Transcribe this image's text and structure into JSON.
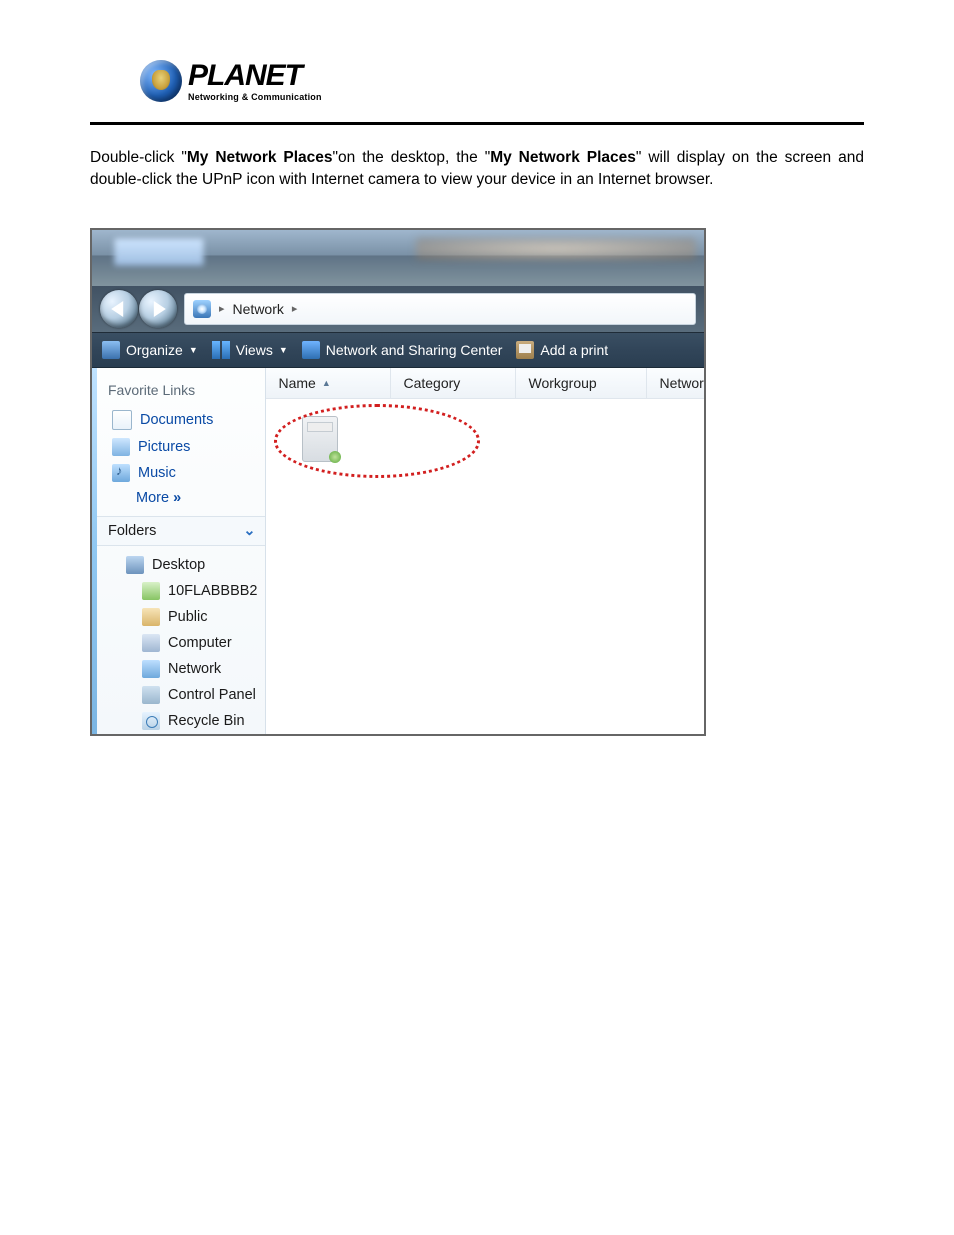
{
  "logo": {
    "brand": "PLANET",
    "tagline": "Networking & Communication"
  },
  "body": {
    "pre1": "Double-click \"",
    "b1": "My Network Places",
    "mid1": "\"on the desktop, the \"",
    "b2": "My Network Places",
    "post": "\" will display on the screen and double-click the UPnP icon with Internet camera to view your device in an Internet browser."
  },
  "addr": {
    "loc": "Network",
    "sep1": "▸",
    "sep2": "▸"
  },
  "toolbar": {
    "organize": "Organize",
    "views": "Views",
    "nsc": "Network and Sharing Center",
    "addprint": "Add a print"
  },
  "left": {
    "fav_heading": "Favorite Links",
    "documents": "Documents",
    "pictures": "Pictures",
    "music": "Music",
    "more": "More",
    "more_arrows": "»",
    "folders_heading": "Folders",
    "desktop": "Desktop",
    "user": "10FLABBBB2",
    "public": "Public",
    "computer": "Computer",
    "network": "Network",
    "cpl": "Control Panel",
    "recycle": "Recycle Bin"
  },
  "cols": {
    "name": "Name",
    "category": "Category",
    "workgroup": "Workgroup",
    "network": "Network"
  }
}
